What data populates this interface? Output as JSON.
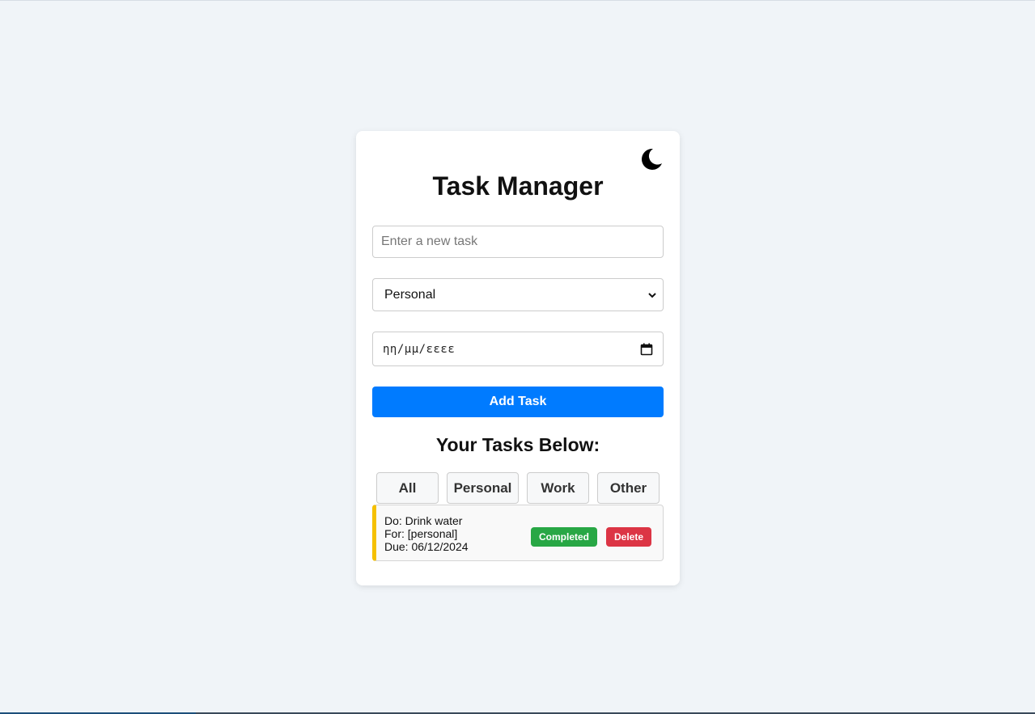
{
  "app": {
    "title": "Task Manager",
    "theme_toggle_icon": "moon-icon"
  },
  "form": {
    "task_placeholder": "Enter a new task",
    "task_value": "",
    "category_selected": "Personal",
    "date_placeholder": "ηη/μμ/εεεε",
    "add_label": "Add Task"
  },
  "tasks_section": {
    "heading": "Your Tasks Below:",
    "filters": [
      {
        "label": "All"
      },
      {
        "label": "Personal"
      },
      {
        "label": "Work"
      },
      {
        "label": "Other"
      }
    ]
  },
  "tasks": [
    {
      "do_line": "Do: Drink water",
      "for_line": "For: [personal]",
      "due_line": "Due: 06/12/2024",
      "completed_label": "Completed",
      "delete_label": "Delete",
      "accent_color": "#f5c000"
    }
  ],
  "colors": {
    "primary": "#007bff",
    "success": "#28a745",
    "danger": "#dc3545",
    "background": "#f0f4f8"
  }
}
